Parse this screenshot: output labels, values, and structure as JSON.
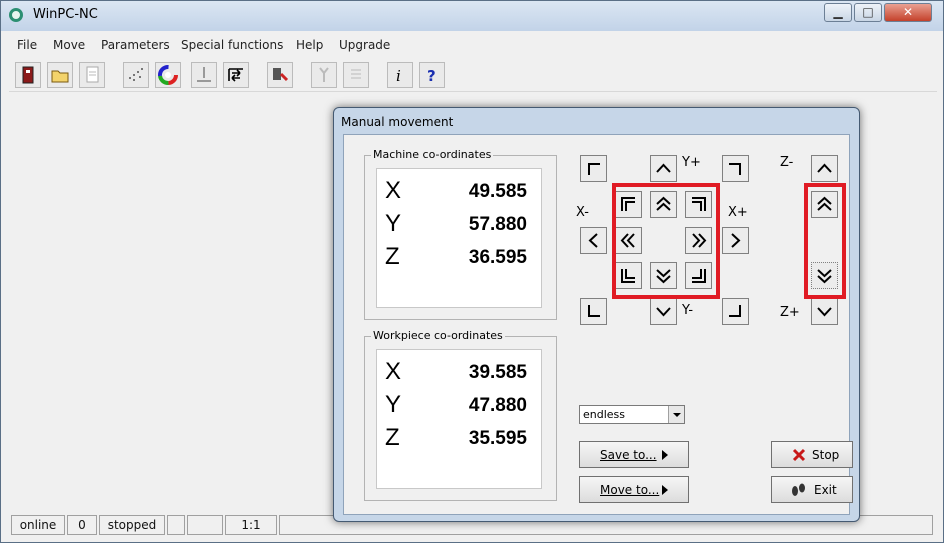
{
  "window": {
    "title": "WinPC-NC",
    "min_glyph": "▁",
    "max_glyph": "□",
    "close_glyph": "✕"
  },
  "menu": [
    "File",
    "Move",
    "Parameters",
    "Special functions",
    "Help",
    "Upgrade"
  ],
  "toolbar_icons": [
    "exit-icon",
    "open-folder-icon",
    "document-icon",
    "dots-grid-icon",
    "color-wheel-icon",
    "probe-icon",
    "reference-run-icon",
    "tool-change-icon",
    "wrench-icon",
    "list-icon",
    "info-icon",
    "help-icon"
  ],
  "help_glyph": "?",
  "info_glyph": "i",
  "status": {
    "connection": "online",
    "count": "0",
    "state": "stopped",
    "scale": "1:1"
  },
  "dialog": {
    "title": "Manual movement",
    "machine": {
      "label": "Machine co-ordinates",
      "x_axis": "X",
      "x": "49.585",
      "y_axis": "Y",
      "y": "57.880",
      "z_axis": "Z",
      "z": "36.595"
    },
    "workpiece": {
      "label": "Workpiece co-ordinates",
      "x_axis": "X",
      "x": "39.585",
      "y_axis": "Y",
      "y": "47.880",
      "z_axis": "Z",
      "z": "35.595"
    },
    "axis_labels": {
      "y_plus": "Y+",
      "y_minus": "Y-",
      "x_minus": "X-",
      "x_plus": "X+",
      "z_minus": "Z-",
      "z_plus": "Z+"
    },
    "step_mode": "endless",
    "save_to": "Save to...",
    "move_to": "Move to...",
    "stop": "Stop",
    "exit": "Exit",
    "highlight_color": "#e01b24"
  }
}
